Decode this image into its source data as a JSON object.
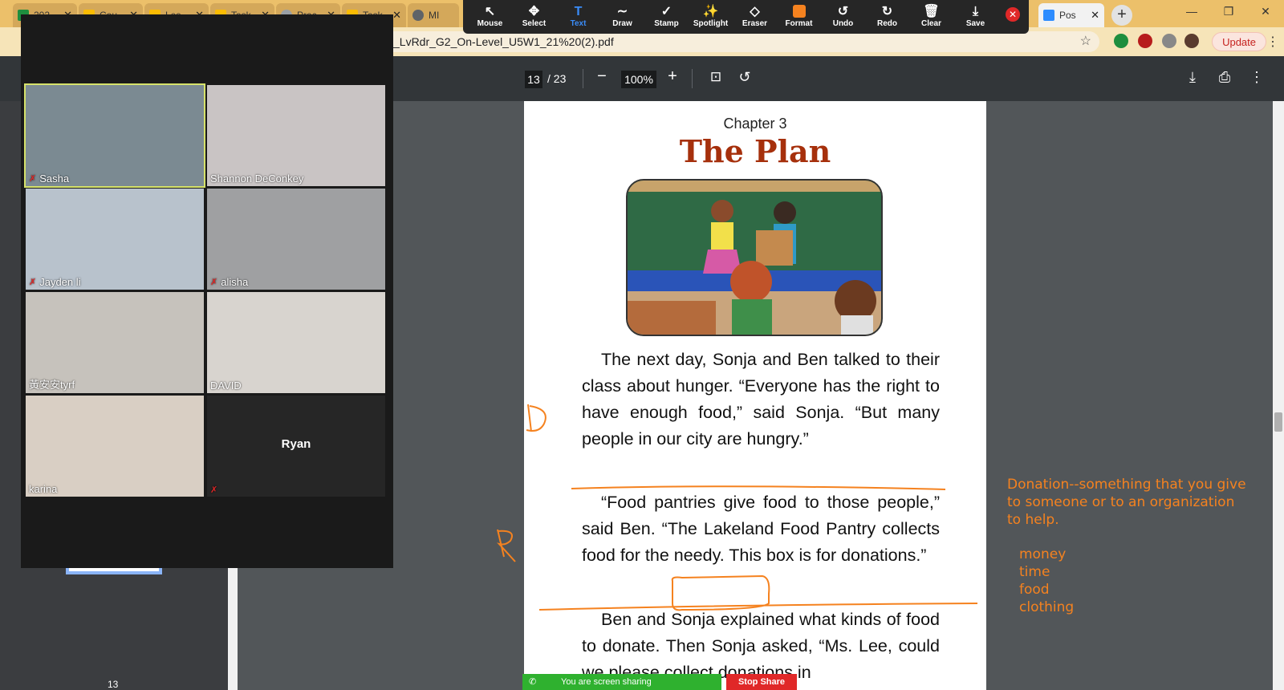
{
  "browser": {
    "tabs": [
      {
        "label": "202",
        "color": "#1e8e3e"
      },
      {
        "label": "Cou",
        "color": "#fbbc04"
      },
      {
        "label": "Les",
        "color": "#fbbc04"
      },
      {
        "label": "Task",
        "color": "#fbbc04"
      },
      {
        "label": "Prac",
        "color": "#9aa0a6"
      },
      {
        "label": "Task",
        "color": "#fbbc04"
      },
      {
        "label": "MI",
        "color": "#5f6368"
      },
      {
        "label": "Pos",
        "color": "#2d8cff"
      }
    ],
    "url": "_LvRdr_G2_On-Level_U5W1_21%20(2).pdf",
    "update_label": "Update"
  },
  "pdf": {
    "current_page": "13",
    "total_pages": "/ 23",
    "zoom": "100%",
    "thumbnail_page": "13"
  },
  "page": {
    "chapter": "Chapter 3",
    "title": "The Plan",
    "paragraphs": [
      "The next day, Sonja and Ben talked to their class about hunger. “Everyone has the right to have enough food,” said Sonja. “But many people in our city are hungry.”",
      "“Food pantries give food to those people,” said Ben. “The Lakeland Food Pantry collects food for the needy. This box is for donations.”",
      "Ben and Sonja explained what kinds of food to donate. Then Sonja asked, “Ms. Lee, could we please collect donations in"
    ]
  },
  "annotations": {
    "margin_d": "D",
    "margin_r": "R",
    "definition": "Donation--something that  you give to someone or to an organization to help.",
    "list": [
      "money",
      "time",
      "food",
      "clothing"
    ],
    "color": "#f5821f"
  },
  "annotation_toolbar": {
    "tools": [
      {
        "label": "Mouse",
        "icon": "↖"
      },
      {
        "label": "Select",
        "icon": "✥"
      },
      {
        "label": "Text",
        "icon": "T"
      },
      {
        "label": "Draw",
        "icon": "∼"
      },
      {
        "label": "Stamp",
        "icon": "✓"
      },
      {
        "label": "Spotlight",
        "icon": "✨"
      },
      {
        "label": "Eraser",
        "icon": "◇"
      },
      {
        "label": "Format",
        "icon": ""
      },
      {
        "label": "Undo",
        "icon": "↺"
      },
      {
        "label": "Redo",
        "icon": "↻"
      },
      {
        "label": "Clear",
        "icon": "␡"
      },
      {
        "label": "Save",
        "icon": "⤓"
      }
    ],
    "selected": "Text"
  },
  "participants": [
    {
      "name": "Sasha",
      "muted": true,
      "active": true,
      "bg": "#7b8a92"
    },
    {
      "name": "Shannon DeConkey",
      "muted": false,
      "active": false,
      "bg": "#c9c4c4"
    },
    {
      "name": "Jayden li",
      "muted": true,
      "active": false,
      "bg": "#b8c2cc"
    },
    {
      "name": "alisha",
      "muted": true,
      "active": false,
      "bg": "#9fa0a2"
    },
    {
      "name": "黃安安tyrf",
      "muted": false,
      "active": false,
      "bg": "#c6c2bc"
    },
    {
      "name": "DAVID",
      "muted": false,
      "active": false,
      "bg": "#d8d4cf"
    },
    {
      "name": "karina",
      "muted": false,
      "active": false,
      "bg": "#d9cfc4"
    },
    {
      "name": "Ryan",
      "muted": true,
      "active": false,
      "bg": "#262626"
    }
  ],
  "share": {
    "status": "You are screen sharing",
    "stop_label": "Stop Share"
  }
}
